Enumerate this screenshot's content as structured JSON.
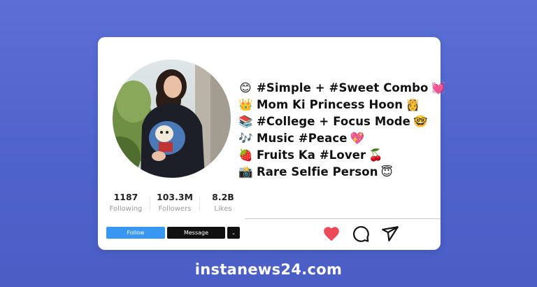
{
  "bio_lines": [
    {
      "icon": "😊",
      "text": "#Simple + #Sweet Combo",
      "end_icon": "💓"
    },
    {
      "icon": "👑",
      "text": "Mom Ki Princess Hoon",
      "end_icon": "👸"
    },
    {
      "icon": "📚",
      "text": "#College + Focus Mode",
      "end_icon": "🤓"
    },
    {
      "icon": "🎶",
      "text": "Music #Peace",
      "end_icon": "💖"
    },
    {
      "icon": "🍓",
      "text": "Fruits Ka #Lover",
      "end_icon": "🍒"
    },
    {
      "icon": "📸",
      "text": "Rare Selfie Person",
      "end_icon": "😇"
    }
  ],
  "stats": {
    "following": {
      "value": "1187",
      "label": "Following"
    },
    "followers": {
      "value": "103.3M",
      "label": "Followers"
    },
    "likes": {
      "value": "8.2B",
      "label": "Likes"
    }
  },
  "buttons": {
    "follow": "Follow",
    "message": "Message",
    "dropdown": "⌄"
  },
  "actions": {
    "like_icon": "heart-icon",
    "comment_icon": "comment-icon",
    "share_icon": "send-icon",
    "like_color": "#ed4956"
  },
  "footer": {
    "site": "instanews24.com"
  },
  "colors": {
    "background": "#5064cc",
    "follow_button": "#3897f0",
    "message_button": "#111111"
  }
}
